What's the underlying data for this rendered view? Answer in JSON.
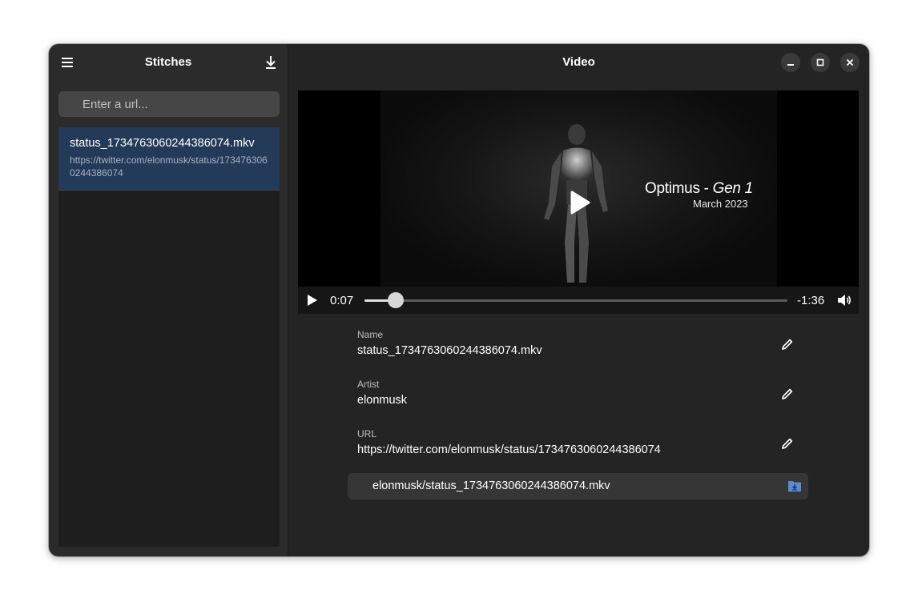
{
  "sidebar": {
    "title": "Stitches",
    "url_placeholder": "Enter a url...",
    "items": [
      {
        "filename": "status_1734763060244386074.mkv",
        "url": "https://twitter.com/elonmusk/status/1734763060244386074"
      }
    ]
  },
  "main": {
    "title": "Video",
    "video": {
      "overlay_title": "Optimus",
      "overlay_dash": " - ",
      "overlay_gen": "Gen 1",
      "overlay_date": "March 2023",
      "time_current": "0:07",
      "time_remaining": "-1:36",
      "progress_fraction": 0.074
    },
    "fields": {
      "name_label": "Name",
      "name_value": "status_1734763060244386074.mkv",
      "artist_label": "Artist",
      "artist_value": "elonmusk",
      "url_label": "URL",
      "url_value": "https://twitter.com/elonmusk/status/1734763060244386074"
    },
    "save_path": "elonmusk/status_1734763060244386074.mkv"
  },
  "icons": {
    "menu": "hamburger-icon",
    "download": "download-icon",
    "minimize": "minimize-icon",
    "maximize": "maximize-icon",
    "close": "close-icon",
    "play": "play-icon",
    "volume": "volume-icon",
    "edit": "pencil-icon",
    "folder": "folder-download-icon"
  },
  "colors": {
    "selected_item_bg": "#243a59",
    "folder_icon": "#5b8ad3"
  }
}
